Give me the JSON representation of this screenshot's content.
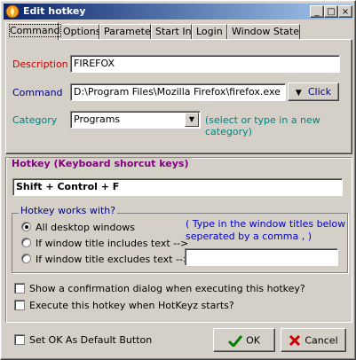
{
  "window": {
    "title": "Edit hotkey",
    "controls": {
      "minimize": "_",
      "maximize": "□",
      "close": "×"
    }
  },
  "tabs": [
    {
      "label": "Command",
      "active": true
    },
    {
      "label": "Options"
    },
    {
      "label": "Parameter"
    },
    {
      "label": "Start In"
    },
    {
      "label": "Login"
    },
    {
      "label": "Window State"
    }
  ],
  "command_tab": {
    "description_label": "Description",
    "description_value": "FIREFOX",
    "command_label": "Command",
    "command_value": "D:\\Program Files\\Mozilla Firefox\\firefox.exe",
    "click_button": "Click",
    "category_label": "Category",
    "category_value": "Programs",
    "category_hint": "(select or type in a new category)"
  },
  "hotkey": {
    "group_label": "Hotkey (Keyboard shorcut keys)",
    "value": "Shift + Control + F",
    "works_with_label": "Hotkey works with?",
    "options": [
      {
        "label": "All desktop windows",
        "selected": true
      },
      {
        "label": "If window title includes text -->",
        "selected": false
      },
      {
        "label": "If window title excludes text -->",
        "selected": false
      }
    ],
    "titles_hint_line1": "( Type in the window titles below",
    "titles_hint_line2": "seperated by a comma , )",
    "titles_value": "",
    "confirm_label": "Show a confirmation dialog when executing this hotkey?",
    "execute_on_start_label": "Execute this hotkey when HotKeyz starts?"
  },
  "footer": {
    "default_label": "Set OK As Default Button",
    "ok_label": "OK",
    "cancel_label": "Cancel"
  },
  "colors": {
    "ok_check": "#008000",
    "cancel_x": "#cc0000",
    "title_start": "#0a246a",
    "title_end": "#a6caf0"
  }
}
